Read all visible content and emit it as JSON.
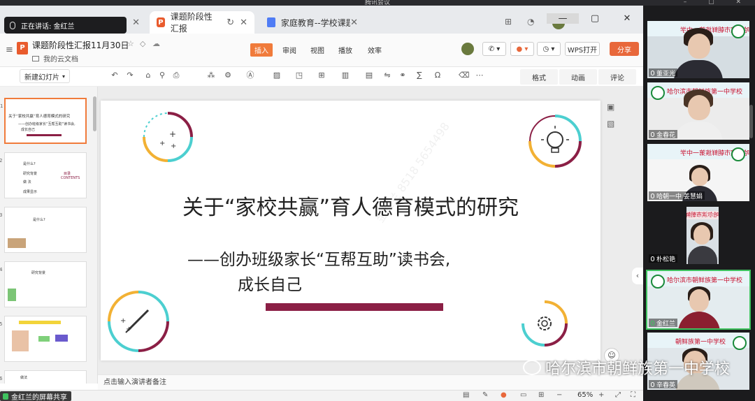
{
  "meeting": {
    "window_title": "腾讯会议",
    "speaker_label": "正在讲话: 金红兰",
    "share_notice": "金红兰的屏幕共享"
  },
  "browser": {
    "tabs": [
      {
        "label": "课题阶段性汇报",
        "active": true
      },
      {
        "label": "家庭教育--学校课题",
        "active": false
      }
    ]
  },
  "wps": {
    "doc_title": "课题阶段性汇报11月30日",
    "cloud_label": "我的云文档",
    "menu": [
      "插入",
      "审阅",
      "视图",
      "播放",
      "效率"
    ],
    "active_menu": "插入",
    "wps_open": "WPS打开",
    "share": "分享",
    "new_slide": "新建幻灯片",
    "right_tabs": [
      "格式",
      "动画",
      "评论"
    ],
    "notes_placeholder": "点击输入演讲者备注",
    "zoom": "65%"
  },
  "thumbnails": [
    {
      "num": "1",
      "lines": [
        "关于“家校共赢”育人德育模式的研究",
        "——创办班级家长“互帮互助”读书会,",
        "成长自己"
      ]
    },
    {
      "num": "2",
      "lines": [
        "是什么?",
        "研究背景",
        "做 法",
        "成果显示",
        "目录",
        "CONTENTS"
      ]
    },
    {
      "num": "3",
      "lines": [
        "是什么?"
      ]
    },
    {
      "num": "4",
      "lines": [
        "研究背景"
      ]
    },
    {
      "num": "5",
      "lines": [
        ""
      ]
    },
    {
      "num": "6",
      "lines": [
        "做法"
      ]
    }
  ],
  "slide": {
    "title": "关于“家校共赢”育人德育模式的研究",
    "subtitle_line1": "——创办班级家长“互帮互助”读书会,",
    "subtitle_line2": "成长自己",
    "watermark": "金红兰 8518 5654498"
  },
  "participants": [
    {
      "name": "董亚光",
      "banner": "哈尔滨市朝鲜族第一中学",
      "mirrored": true
    },
    {
      "name": "金春花",
      "banner": "哈尔滨市朝鲜族第一中学校",
      "mirrored": false
    },
    {
      "name": "哈朝一中 姜慧娟",
      "banner": "哈尔滨市朝鲜族第一中学",
      "mirrored": true
    },
    {
      "name": "朴松艳",
      "banner": "哈尔滨市朝鲜",
      "mirrored": true
    },
    {
      "name": "金红兰",
      "banner": "哈尔滨市朝鲜族第一中学校",
      "mirrored": false,
      "speaking": true
    },
    {
      "name": "辛春英",
      "banner": "朝鲜族第一中学校",
      "mirrored": false
    }
  ],
  "wechat_watermark": "哈尔滨市朝鲜族第一中学校",
  "colors": {
    "accent_orange": "#e8683b",
    "slide_maroon": "#8b1f45",
    "slide_teal": "#4ccfd0",
    "slide_yellow": "#f2b134",
    "speaking_green": "#3fc35f"
  }
}
